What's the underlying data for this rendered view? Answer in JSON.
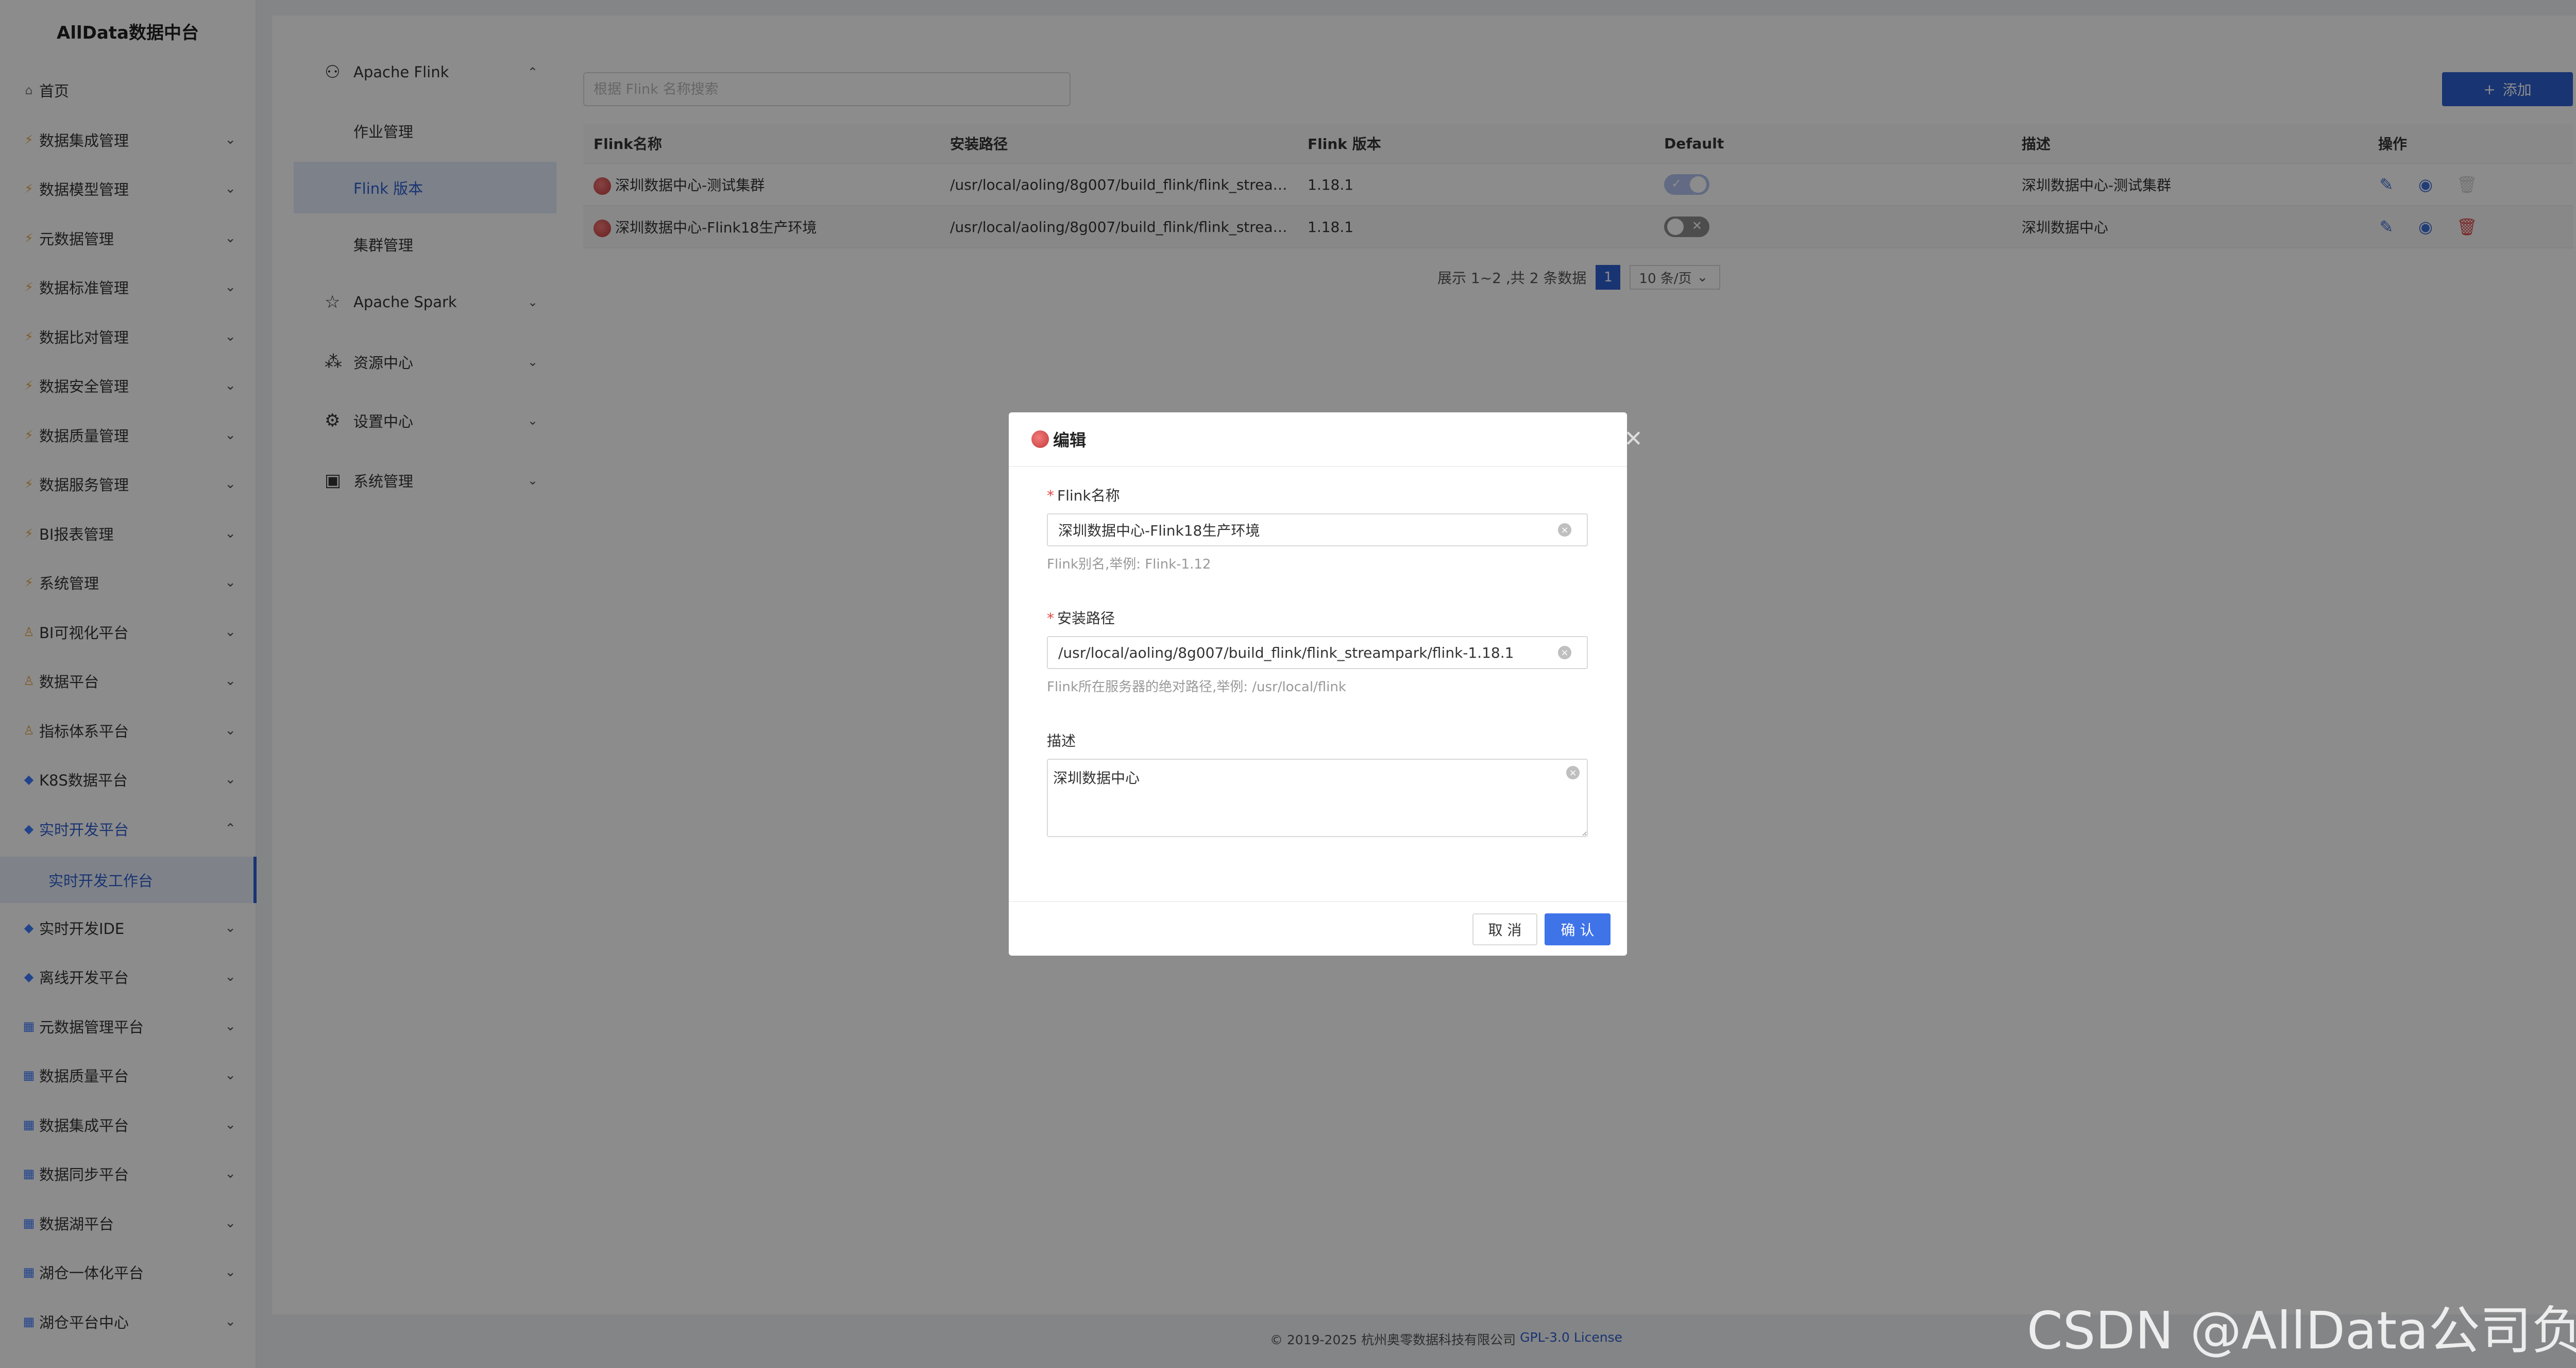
{
  "app": {
    "title": "AllData数据中台"
  },
  "sidebar": {
    "items": [
      {
        "label": "首页",
        "icon": "home-icon"
      },
      {
        "label": "数据集成管理",
        "icon": "lightning-icon"
      },
      {
        "label": "数据模型管理",
        "icon": "lightning-icon"
      },
      {
        "label": "元数据管理",
        "icon": "lightning-icon"
      },
      {
        "label": "数据标准管理",
        "icon": "lightning-icon"
      },
      {
        "label": "数据比对管理",
        "icon": "lightning-icon"
      },
      {
        "label": "数据安全管理",
        "icon": "lightning-icon"
      },
      {
        "label": "数据质量管理",
        "icon": "lightning-icon"
      },
      {
        "label": "数据服务管理",
        "icon": "lightning-icon"
      },
      {
        "label": "BI报表管理",
        "icon": "lightning-icon"
      },
      {
        "label": "系统管理",
        "icon": "lightning-icon"
      },
      {
        "label": "BI可视化平台",
        "icon": "person-icon"
      },
      {
        "label": "数据平台",
        "icon": "person-icon"
      },
      {
        "label": "指标体系平台",
        "icon": "person-icon"
      },
      {
        "label": "K8S数据平台",
        "icon": "diamond-icon"
      },
      {
        "label": "实时开发平台",
        "icon": "diamond-icon"
      },
      {
        "label": "实时开发IDE",
        "icon": "diamond-icon"
      },
      {
        "label": "离线开发平台",
        "icon": "diamond-icon"
      },
      {
        "label": "元数据管理平台",
        "icon": "grid-icon"
      },
      {
        "label": "数据质量平台",
        "icon": "grid-icon"
      },
      {
        "label": "数据集成平台",
        "icon": "grid-icon"
      },
      {
        "label": "数据同步平台",
        "icon": "grid-icon"
      },
      {
        "label": "数据湖平台",
        "icon": "grid-icon"
      },
      {
        "label": "湖仓一体化平台",
        "icon": "grid-icon"
      },
      {
        "label": "湖仓平台中心",
        "icon": "grid-icon"
      }
    ],
    "active_sub": "实时开发工作台"
  },
  "subnav": {
    "flink": "Apache Flink",
    "flink_children": [
      "作业管理",
      "Flink 版本",
      "集群管理"
    ],
    "spark": "Apache Spark",
    "resource": "资源中心",
    "settings": "设置中心",
    "system": "系统管理"
  },
  "search": {
    "placeholder": "根据 Flink 名称搜索"
  },
  "toolbar": {
    "add_label": "添加"
  },
  "table": {
    "columns": [
      "Flink名称",
      "安装路径",
      "Flink 版本",
      "Default",
      "描述",
      "操作"
    ],
    "rows": [
      {
        "name": "深圳数据中心-测试集群",
        "path": "/usr/local/aoling/8g007/build_flink/flink_streampa...",
        "version": "1.18.1",
        "default": true,
        "desc": "深圳数据中心-测试集群"
      },
      {
        "name": "深圳数据中心-Flink18生产环境",
        "path": "/usr/local/aoling/8g007/build_flink/flink_streampa...",
        "version": "1.18.1",
        "default": false,
        "desc": "深圳数据中心"
      }
    ]
  },
  "pager": {
    "summary": "展示 1~2 ,共 2 条数据",
    "current": "1",
    "page_size": "10 条/页"
  },
  "footer": {
    "copyright": "© 2019-2025 杭州奥零数据科技有限公司",
    "license": "GPL-3.0 License"
  },
  "modal": {
    "title": "编辑",
    "name_label": "Flink名称",
    "name_value": "深圳数据中心-Flink18生产环境",
    "name_help": "Flink别名,举例: Flink-1.12",
    "path_label": "安装路径",
    "path_value": "/usr/local/aoling/8g007/build_flink/flink_streampark/flink-1.18.1",
    "path_help": "Flink所在服务器的绝对路径,举例: /usr/local/flink",
    "desc_label": "描述",
    "desc_value": "深圳数据中心",
    "cancel": "取 消",
    "ok": "确 认"
  },
  "watermark": "CSDN @AllData公司负责人",
  "colors": {
    "primary": "#2f5fd0",
    "danger": "#e04545"
  }
}
